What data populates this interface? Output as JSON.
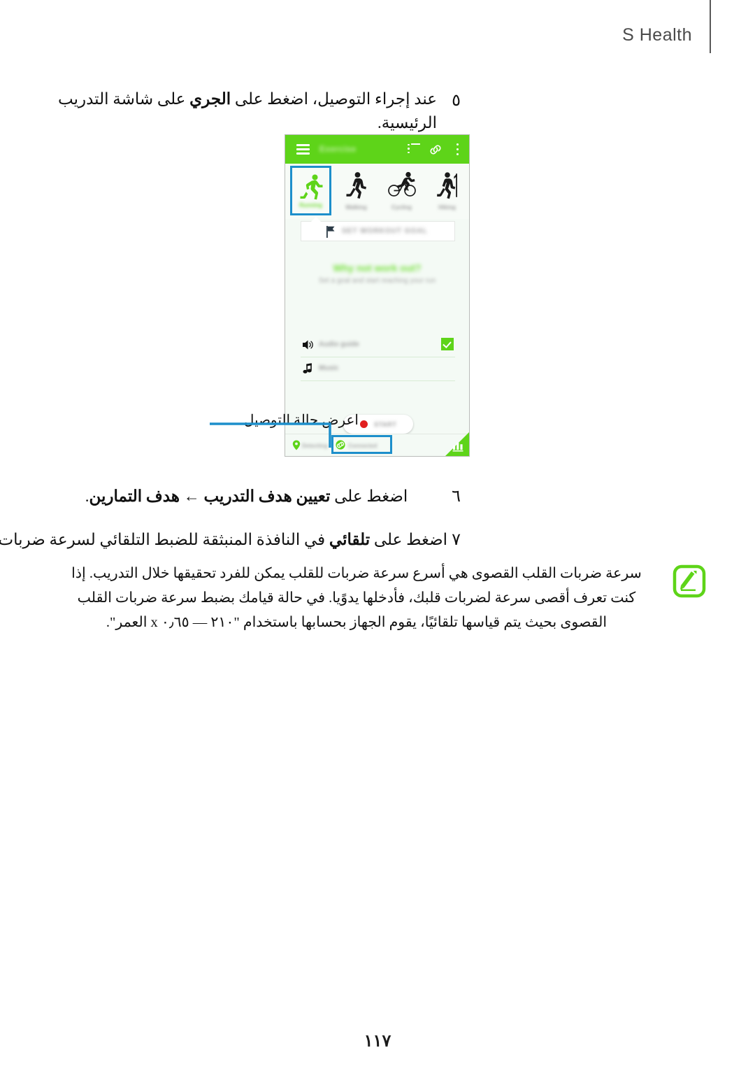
{
  "header": {
    "title": "S Health"
  },
  "steps": [
    {
      "number": "٥",
      "pre": "عند إجراء التوصيل، اضغط على ",
      "bold": "الجري",
      "post": " على شاشة التدريب الرئيسية."
    },
    {
      "number": "٦",
      "pre": "اضغط على ",
      "bold": "تعيين هدف التدريب ← هدف التمارين",
      "post": "."
    },
    {
      "number": "٧",
      "pre": "اضغط على ",
      "bold": "تلقائي",
      "post": " في النافذة المنبثقة للضبط التلقائي لسرعة ضربات القلب القصوى."
    }
  ],
  "callout": {
    "label": "اعرض حالة التوصيل.",
    "line_color": "#1d8fcb"
  },
  "phone": {
    "appbar": {
      "title": "Exercise",
      "accent_color": "#5ed419"
    },
    "exercises": [
      {
        "label": "Running",
        "icon": "running-icon",
        "selected": true
      },
      {
        "label": "Walking",
        "icon": "walking-icon",
        "selected": false
      },
      {
        "label": "Cycling",
        "icon": "cycling-icon",
        "selected": false
      },
      {
        "label": "Hiking",
        "icon": "hiking-icon",
        "selected": false
      }
    ],
    "goal_card": {
      "label": "SET WORKOUT GOAL",
      "icon": "flag-icon"
    },
    "promo": {
      "title": "Why not work out?",
      "subtitle": "Set a goal and start reaching your run"
    },
    "options": [
      {
        "label": "Audio guide",
        "icon": "audio-guide-icon",
        "checked": true
      },
      {
        "label": "Music",
        "icon": "music-note-icon",
        "checked": false
      }
    ],
    "start_button": {
      "label": "START",
      "dot_color": "#e11f1f"
    },
    "bottom_bar": {
      "location_label": "Detecting",
      "location_icon": "location-pin-icon",
      "connection_label": "Connected",
      "connection_icon": "link-connected-icon",
      "chart_icon": "bar-chart-icon"
    }
  },
  "note": {
    "icon": "note-pencil-icon",
    "icon_color": "#5ed419",
    "text": "سرعة ضربات القلب القصوى هي أسرع سرعة ضربات للقلب يمكن للفرد تحقيقها خلال التدريب. إذا كنت تعرف أقصى سرعة لضربات قلبك، فأدخلها يدوًيا. في حالة قيامك بضبط سرعة ضربات القلب القصوى بحيث يتم قياسها تلقائيًا، يقوم الجهاز بحسابها باستخدام \"٢١٠ — ٠٫٦٥ x العمر\"."
  },
  "page_number": "١١٧"
}
